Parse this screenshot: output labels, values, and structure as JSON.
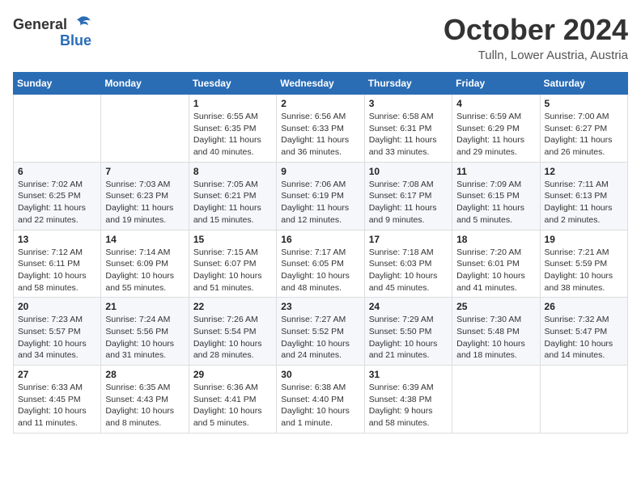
{
  "header": {
    "logo_general": "General",
    "logo_blue": "Blue",
    "month_year": "October 2024",
    "location": "Tulln, Lower Austria, Austria"
  },
  "weekdays": [
    "Sunday",
    "Monday",
    "Tuesday",
    "Wednesday",
    "Thursday",
    "Friday",
    "Saturday"
  ],
  "weeks": [
    [
      {
        "day": "",
        "info": ""
      },
      {
        "day": "",
        "info": ""
      },
      {
        "day": "1",
        "info": "Sunrise: 6:55 AM\nSunset: 6:35 PM\nDaylight: 11 hours and 40 minutes."
      },
      {
        "day": "2",
        "info": "Sunrise: 6:56 AM\nSunset: 6:33 PM\nDaylight: 11 hours and 36 minutes."
      },
      {
        "day": "3",
        "info": "Sunrise: 6:58 AM\nSunset: 6:31 PM\nDaylight: 11 hours and 33 minutes."
      },
      {
        "day": "4",
        "info": "Sunrise: 6:59 AM\nSunset: 6:29 PM\nDaylight: 11 hours and 29 minutes."
      },
      {
        "day": "5",
        "info": "Sunrise: 7:00 AM\nSunset: 6:27 PM\nDaylight: 11 hours and 26 minutes."
      }
    ],
    [
      {
        "day": "6",
        "info": "Sunrise: 7:02 AM\nSunset: 6:25 PM\nDaylight: 11 hours and 22 minutes."
      },
      {
        "day": "7",
        "info": "Sunrise: 7:03 AM\nSunset: 6:23 PM\nDaylight: 11 hours and 19 minutes."
      },
      {
        "day": "8",
        "info": "Sunrise: 7:05 AM\nSunset: 6:21 PM\nDaylight: 11 hours and 15 minutes."
      },
      {
        "day": "9",
        "info": "Sunrise: 7:06 AM\nSunset: 6:19 PM\nDaylight: 11 hours and 12 minutes."
      },
      {
        "day": "10",
        "info": "Sunrise: 7:08 AM\nSunset: 6:17 PM\nDaylight: 11 hours and 9 minutes."
      },
      {
        "day": "11",
        "info": "Sunrise: 7:09 AM\nSunset: 6:15 PM\nDaylight: 11 hours and 5 minutes."
      },
      {
        "day": "12",
        "info": "Sunrise: 7:11 AM\nSunset: 6:13 PM\nDaylight: 11 hours and 2 minutes."
      }
    ],
    [
      {
        "day": "13",
        "info": "Sunrise: 7:12 AM\nSunset: 6:11 PM\nDaylight: 10 hours and 58 minutes."
      },
      {
        "day": "14",
        "info": "Sunrise: 7:14 AM\nSunset: 6:09 PM\nDaylight: 10 hours and 55 minutes."
      },
      {
        "day": "15",
        "info": "Sunrise: 7:15 AM\nSunset: 6:07 PM\nDaylight: 10 hours and 51 minutes."
      },
      {
        "day": "16",
        "info": "Sunrise: 7:17 AM\nSunset: 6:05 PM\nDaylight: 10 hours and 48 minutes."
      },
      {
        "day": "17",
        "info": "Sunrise: 7:18 AM\nSunset: 6:03 PM\nDaylight: 10 hours and 45 minutes."
      },
      {
        "day": "18",
        "info": "Sunrise: 7:20 AM\nSunset: 6:01 PM\nDaylight: 10 hours and 41 minutes."
      },
      {
        "day": "19",
        "info": "Sunrise: 7:21 AM\nSunset: 5:59 PM\nDaylight: 10 hours and 38 minutes."
      }
    ],
    [
      {
        "day": "20",
        "info": "Sunrise: 7:23 AM\nSunset: 5:57 PM\nDaylight: 10 hours and 34 minutes."
      },
      {
        "day": "21",
        "info": "Sunrise: 7:24 AM\nSunset: 5:56 PM\nDaylight: 10 hours and 31 minutes."
      },
      {
        "day": "22",
        "info": "Sunrise: 7:26 AM\nSunset: 5:54 PM\nDaylight: 10 hours and 28 minutes."
      },
      {
        "day": "23",
        "info": "Sunrise: 7:27 AM\nSunset: 5:52 PM\nDaylight: 10 hours and 24 minutes."
      },
      {
        "day": "24",
        "info": "Sunrise: 7:29 AM\nSunset: 5:50 PM\nDaylight: 10 hours and 21 minutes."
      },
      {
        "day": "25",
        "info": "Sunrise: 7:30 AM\nSunset: 5:48 PM\nDaylight: 10 hours and 18 minutes."
      },
      {
        "day": "26",
        "info": "Sunrise: 7:32 AM\nSunset: 5:47 PM\nDaylight: 10 hours and 14 minutes."
      }
    ],
    [
      {
        "day": "27",
        "info": "Sunrise: 6:33 AM\nSunset: 4:45 PM\nDaylight: 10 hours and 11 minutes."
      },
      {
        "day": "28",
        "info": "Sunrise: 6:35 AM\nSunset: 4:43 PM\nDaylight: 10 hours and 8 minutes."
      },
      {
        "day": "29",
        "info": "Sunrise: 6:36 AM\nSunset: 4:41 PM\nDaylight: 10 hours and 5 minutes."
      },
      {
        "day": "30",
        "info": "Sunrise: 6:38 AM\nSunset: 4:40 PM\nDaylight: 10 hours and 1 minute."
      },
      {
        "day": "31",
        "info": "Sunrise: 6:39 AM\nSunset: 4:38 PM\nDaylight: 9 hours and 58 minutes."
      },
      {
        "day": "",
        "info": ""
      },
      {
        "day": "",
        "info": ""
      }
    ]
  ]
}
